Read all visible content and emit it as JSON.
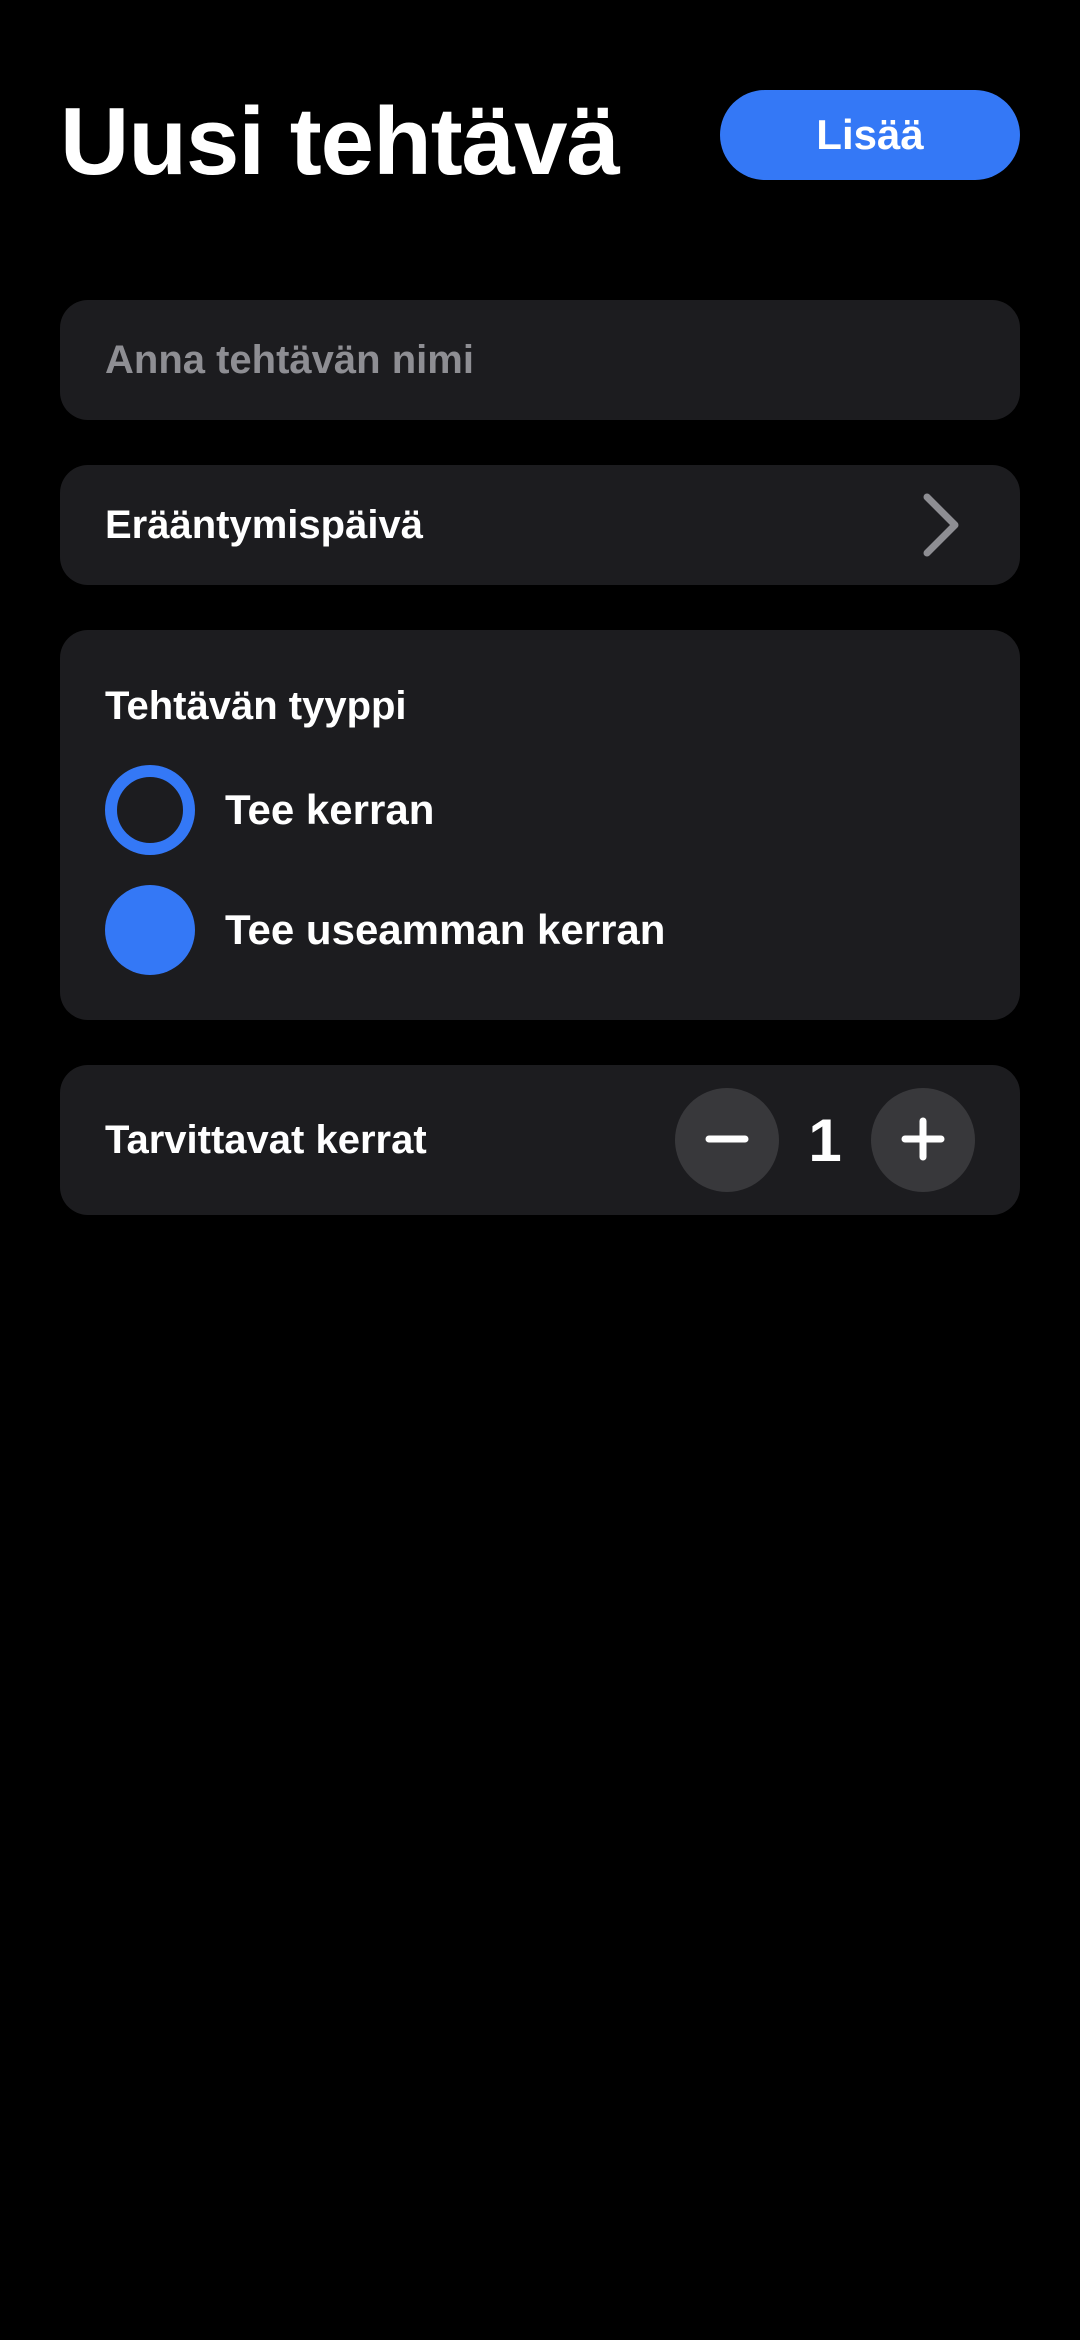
{
  "header": {
    "title": "Uusi tehtävä",
    "add_button_label": "Lisää"
  },
  "task_name": {
    "value": "",
    "placeholder": "Anna tehtävän nimi"
  },
  "due_date": {
    "label": "Erääntymispäivä",
    "icon": "chevron-right-icon"
  },
  "task_type": {
    "heading": "Tehtävän tyyppi",
    "options": [
      {
        "label": "Tee kerran",
        "selected": false
      },
      {
        "label": "Tee useamman kerran",
        "selected": true
      }
    ]
  },
  "required_count": {
    "label": "Tarvittavat kerrat",
    "value": "1",
    "decrement_icon": "minus-icon",
    "increment_icon": "plus-icon"
  },
  "colors": {
    "accent": "#3478f6",
    "background": "#000000",
    "card": "#1c1c1f",
    "stepper_button": "#38383b",
    "placeholder": "#8e8e93",
    "chevron": "#8e8e93"
  }
}
